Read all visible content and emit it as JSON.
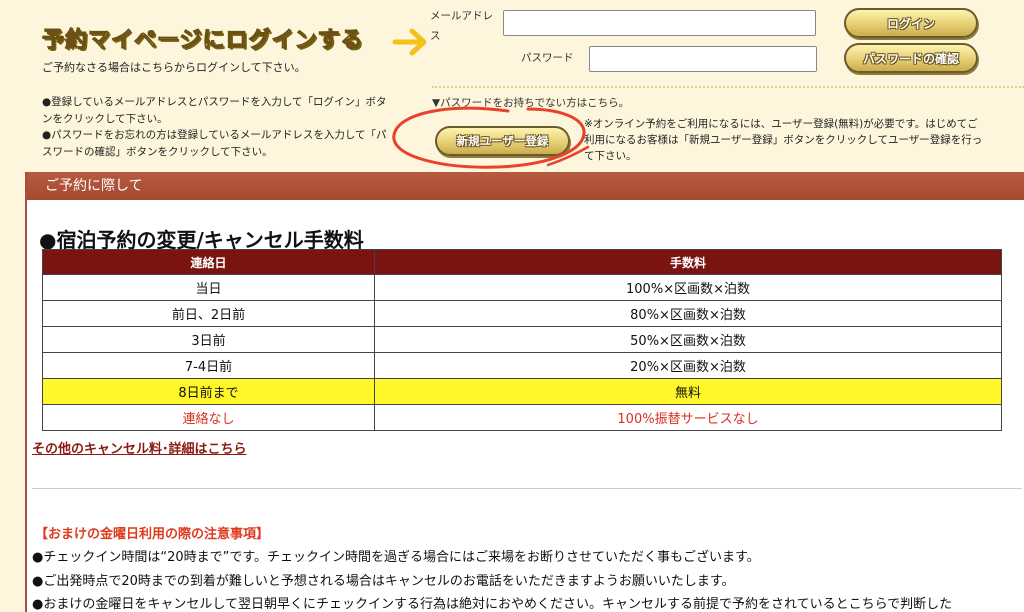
{
  "login": {
    "title": "予約マイページにログインする",
    "subtitle": "ご予約なさる場合はこちらからログインして下さい。",
    "notes": [
      "●登録しているメールアドレスとパスワードを入力して「ログイン」ボタンをクリックして下さい。",
      "●パスワードをお忘れの方は登録しているメールアドレスを入力して「パスワードの確認」ボタンをクリックして下さい。"
    ],
    "email_label": "メールアドレス",
    "email_value": "",
    "password_label": "パスワード",
    "password_value": "",
    "login_button": "ログイン",
    "password_confirm_button": "パスワードの確認",
    "no_password_text": "▼パスワードをお持ちでない方はこちら。",
    "register_button": "新規ユーザー登録",
    "register_note": "※オンライン予約をご利用になるには、ユーザー登録(無料)が必要です。はじめてご利用になるお客様は「新規ユーザー登録」ボタンをクリックしてユーザー登録を行って下さい。"
  },
  "panel": {
    "header": "ご予約に際して",
    "section_title": "●宿泊予約の変更/キャンセル手数料",
    "table": {
      "headers": [
        "連絡日",
        "手数料"
      ],
      "rows": [
        [
          "当日",
          "100%×区画数×泊数"
        ],
        [
          "前日、2日前",
          "80%×区画数×泊数"
        ],
        [
          "3日前",
          "50%×区画数×泊数"
        ],
        [
          "7-4日前",
          "20%×区画数×泊数"
        ],
        [
          "8日前まで",
          "無料"
        ],
        [
          "連絡なし",
          "100%振替サービスなし"
        ]
      ]
    },
    "more_link": "その他のキャンセル料･詳細はこちら",
    "friday": {
      "heading": "【おまけの金曜日利用の際の注意事項】",
      "lines": [
        "●チェックイン時間は“20時まで”です。チェックイン時間を過ぎる場合にはご来場をお断りさせていただく事もございます。",
        "●ご出発時点で20時までの到着が難しいと予想される場合はキャンセルのお電話をいただきますようお願いいたします。",
        "●おまけの金曜日をキャンセルして翌日朝早くにチェックインする行為は絶対におやめください。キャンセルする前提で予約をされているとこちらで判断した"
      ]
    }
  },
  "colors": {
    "background": "#fdf6dc",
    "panel_header": "#a54a31",
    "table_header": "#7a1411",
    "highlight_yellow": "#fff72a",
    "accent_red": "#d8321e",
    "annotation_circle": "#e8412c",
    "arrow": "#f2c21a"
  }
}
